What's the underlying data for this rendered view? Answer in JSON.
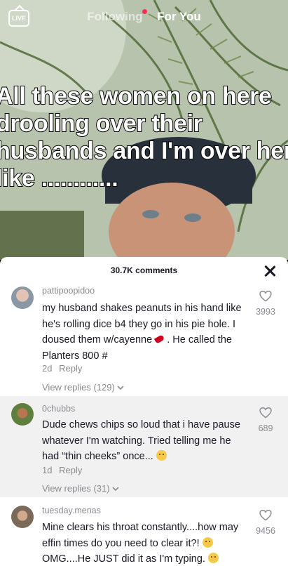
{
  "top_nav": {
    "live_label": "LIVE",
    "following_label": "Following",
    "for_you_label": "For You"
  },
  "video": {
    "caption_lines": [
      "All these women on here",
      "drooling over their",
      "husbands and I'm over here",
      "like ............"
    ]
  },
  "sheet": {
    "count_label": "30.7K comments",
    "comments": [
      {
        "username": "pattipoopidoo",
        "text_lines": [
          "my husband shakes peanuts in his hand like",
          "he's rolling dice b4 they go in his pie hole. I",
          "doused them w/cayenne",
          ". He called the",
          "Planters 800 #"
        ],
        "time": "2d",
        "reply_label": "Reply",
        "likes": "3993",
        "view_replies": "View replies (129)"
      },
      {
        "username": "0chubbs",
        "text_lines": [
          "Dude chews chips so loud that i have pause",
          "whatever I'm watching. Tried telling me he",
          "had “thin cheeks” once..."
        ],
        "time": "1d",
        "reply_label": "Reply",
        "likes": "689",
        "view_replies": "View replies (31)"
      },
      {
        "username": "tuesday.menas",
        "text_lines": [
          "Mine clears his throat constantly....how may",
          "effin times do you need to clear it?!",
          "OMG....He JUST did it as I'm typing."
        ],
        "likes": "9456"
      }
    ]
  },
  "colors": {
    "accent": "#fe2c55",
    "secondary_text": "#8a8b91",
    "primary_text": "#161823"
  }
}
